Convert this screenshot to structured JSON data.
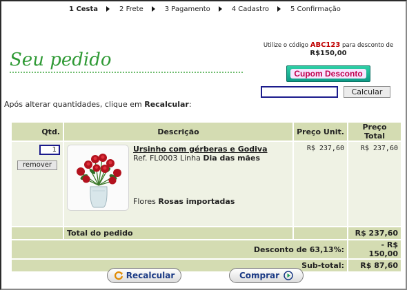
{
  "steps": [
    {
      "label": "1 Cesta"
    },
    {
      "label": "2 Frete"
    },
    {
      "label": "3 Pagamento"
    },
    {
      "label": "4 Cadastro"
    },
    {
      "label": "5 Confirmação"
    }
  ],
  "promo": {
    "text_before": "Utilize o código",
    "code": "ABC123",
    "text_after": "para desconto de",
    "amount": "R$150,00"
  },
  "title": "Seu pedido",
  "coupon": {
    "button_label": "Cupom Desconto",
    "input_value": "",
    "calc_label": "Calcular"
  },
  "hint": {
    "text": "Após alterar quantidades, clique em",
    "bold": "Recalcular",
    "suffix": ":"
  },
  "table": {
    "headers": {
      "qty": "Qtd.",
      "desc": "Descrição",
      "unit": "Preço Unit.",
      "total": "Preço Total"
    },
    "item": {
      "qty": "1",
      "remove_label": "remover",
      "name": "Ursinho com gérberas e Godiva",
      "ref": "Ref. FL0003",
      "linha_label": "Linha",
      "linha": "Dia das mães",
      "flores_label": "Flores",
      "flores": "Rosas importadas",
      "unit_price": "R$ 237,60",
      "total_price": "R$ 237,60"
    },
    "total_label": "Total do pedido",
    "total_value": "R$ 237,60",
    "discount_label": "Desconto de 63,13%:",
    "discount_value": "- R$ 150,00",
    "subtotal_label": "Sub-total:",
    "subtotal_value": "R$ 87,60"
  },
  "buttons": {
    "recalc": "Recalcular",
    "comprar": "Comprar"
  },
  "colors": {
    "header_bg": "#d4dcb2",
    "row_bg": "#eff2e4",
    "title": "#2f9a35",
    "code": "#c00000",
    "cupom_btn": "#16b394"
  }
}
